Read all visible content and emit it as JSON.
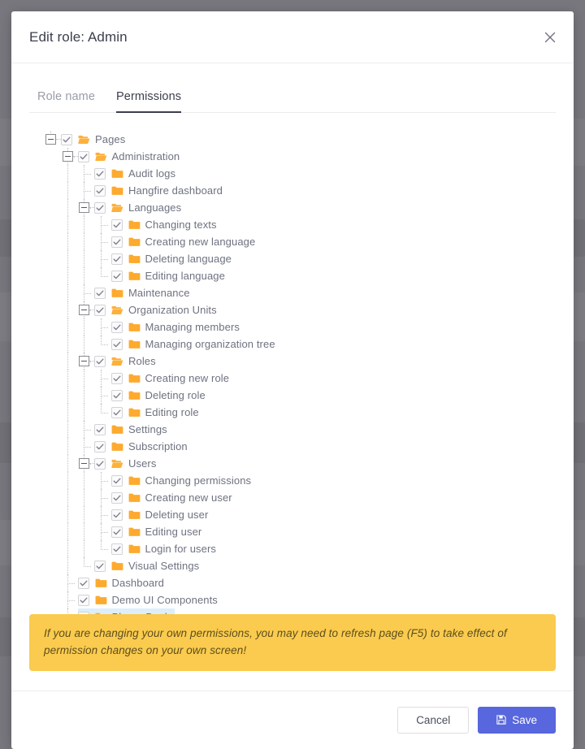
{
  "dialog": {
    "title": "Edit role: Admin",
    "close_icon": "close-icon"
  },
  "tabs": [
    {
      "label": "Role name",
      "active": false
    },
    {
      "label": "Permissions",
      "active": true
    }
  ],
  "tree": {
    "nodes": [
      {
        "label": "Pages",
        "level": 0,
        "checked": true,
        "expandable": true,
        "expanded": true,
        "icon": "folder-open-icon",
        "selected": false
      },
      {
        "label": "Administration",
        "level": 1,
        "checked": true,
        "expandable": true,
        "expanded": true,
        "icon": "folder-open-icon",
        "selected": false
      },
      {
        "label": "Audit logs",
        "level": 2,
        "checked": true,
        "expandable": false,
        "expanded": false,
        "icon": "folder-icon",
        "selected": false
      },
      {
        "label": "Hangfire dashboard",
        "level": 2,
        "checked": true,
        "expandable": false,
        "expanded": false,
        "icon": "folder-icon",
        "selected": false
      },
      {
        "label": "Languages",
        "level": 2,
        "checked": true,
        "expandable": true,
        "expanded": true,
        "icon": "folder-open-icon",
        "selected": false
      },
      {
        "label": "Changing texts",
        "level": 3,
        "checked": true,
        "expandable": false,
        "expanded": false,
        "icon": "folder-icon",
        "selected": false
      },
      {
        "label": "Creating new language",
        "level": 3,
        "checked": true,
        "expandable": false,
        "expanded": false,
        "icon": "folder-icon",
        "selected": false
      },
      {
        "label": "Deleting language",
        "level": 3,
        "checked": true,
        "expandable": false,
        "expanded": false,
        "icon": "folder-icon",
        "selected": false
      },
      {
        "label": "Editing language",
        "level": 3,
        "checked": true,
        "expandable": false,
        "expanded": false,
        "icon": "folder-icon",
        "selected": false,
        "last_child": true
      },
      {
        "label": "Maintenance",
        "level": 2,
        "checked": true,
        "expandable": false,
        "expanded": false,
        "icon": "folder-icon",
        "selected": false
      },
      {
        "label": "Organization Units",
        "level": 2,
        "checked": true,
        "expandable": true,
        "expanded": true,
        "icon": "folder-open-icon",
        "selected": false
      },
      {
        "label": "Managing members",
        "level": 3,
        "checked": true,
        "expandable": false,
        "expanded": false,
        "icon": "folder-icon",
        "selected": false
      },
      {
        "label": "Managing organization tree",
        "level": 3,
        "checked": true,
        "expandable": false,
        "expanded": false,
        "icon": "folder-icon",
        "selected": false,
        "last_child": true
      },
      {
        "label": "Roles",
        "level": 2,
        "checked": true,
        "expandable": true,
        "expanded": true,
        "icon": "folder-open-icon",
        "selected": false
      },
      {
        "label": "Creating new role",
        "level": 3,
        "checked": true,
        "expandable": false,
        "expanded": false,
        "icon": "folder-icon",
        "selected": false
      },
      {
        "label": "Deleting role",
        "level": 3,
        "checked": true,
        "expandable": false,
        "expanded": false,
        "icon": "folder-icon",
        "selected": false
      },
      {
        "label": "Editing role",
        "level": 3,
        "checked": true,
        "expandable": false,
        "expanded": false,
        "icon": "folder-icon",
        "selected": false,
        "last_child": true
      },
      {
        "label": "Settings",
        "level": 2,
        "checked": true,
        "expandable": false,
        "expanded": false,
        "icon": "folder-icon",
        "selected": false
      },
      {
        "label": "Subscription",
        "level": 2,
        "checked": true,
        "expandable": false,
        "expanded": false,
        "icon": "folder-icon",
        "selected": false
      },
      {
        "label": "Users",
        "level": 2,
        "checked": true,
        "expandable": true,
        "expanded": true,
        "icon": "folder-open-icon",
        "selected": false
      },
      {
        "label": "Changing permissions",
        "level": 3,
        "checked": true,
        "expandable": false,
        "expanded": false,
        "icon": "folder-icon",
        "selected": false
      },
      {
        "label": "Creating new user",
        "level": 3,
        "checked": true,
        "expandable": false,
        "expanded": false,
        "icon": "folder-icon",
        "selected": false
      },
      {
        "label": "Deleting user",
        "level": 3,
        "checked": true,
        "expandable": false,
        "expanded": false,
        "icon": "folder-icon",
        "selected": false
      },
      {
        "label": "Editing user",
        "level": 3,
        "checked": true,
        "expandable": false,
        "expanded": false,
        "icon": "folder-icon",
        "selected": false
      },
      {
        "label": "Login for users",
        "level": 3,
        "checked": true,
        "expandable": false,
        "expanded": false,
        "icon": "folder-icon",
        "selected": false,
        "last_child": true
      },
      {
        "label": "Visual Settings",
        "level": 2,
        "checked": true,
        "expandable": false,
        "expanded": false,
        "icon": "folder-icon",
        "selected": false,
        "last_child": true
      },
      {
        "label": "Dashboard",
        "level": 1,
        "checked": true,
        "expandable": false,
        "expanded": false,
        "icon": "folder-icon",
        "selected": false
      },
      {
        "label": "Demo UI Components",
        "level": 1,
        "checked": true,
        "expandable": false,
        "expanded": false,
        "icon": "folder-icon",
        "selected": false
      },
      {
        "label": "Phone Book",
        "level": 1,
        "checked": true,
        "expandable": false,
        "expanded": false,
        "icon": "folder-icon",
        "selected": true,
        "last_child": true
      }
    ]
  },
  "alert": {
    "text": "If you are changing your own permissions, you may need to refresh page (F5) to take effect of permission changes on your own screen!"
  },
  "footer": {
    "cancel_label": "Cancel",
    "save_label": "Save",
    "save_icon": "save-floppy-icon"
  },
  "colors": {
    "accent_blue": "#5867dd",
    "folder_orange": "#fdaa2e",
    "alert_amber": "#facb4e",
    "selection_blue": "#dceefb"
  }
}
